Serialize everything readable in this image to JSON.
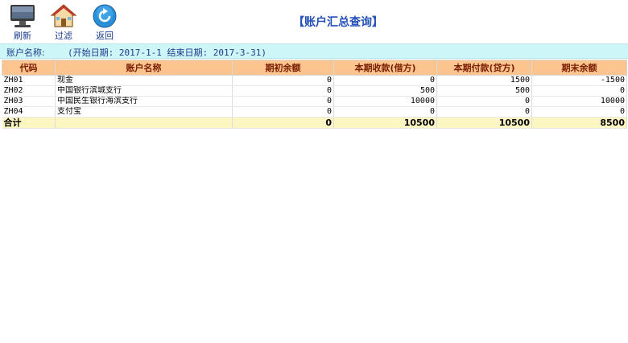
{
  "toolbar": {
    "refresh_label": "刷新",
    "filter_label": "过滤",
    "back_label": "返回"
  },
  "title": "【账户汇总查询】",
  "info": {
    "account_label": "账户名称:",
    "date_range": "(开始日期: 2017-1-1 结束日期: 2017-3-31)"
  },
  "table": {
    "headers": [
      "代码",
      "账户名称",
      "期初余额",
      "本期收款(借方)",
      "本期付款(贷方)",
      "期末余额"
    ],
    "rows": [
      {
        "code": "ZH01",
        "name": "现金",
        "opening": "0",
        "debit": "0",
        "credit": "1500",
        "closing": "-1500"
      },
      {
        "code": "ZH02",
        "name": "中国银行滨城支行",
        "opening": "0",
        "debit": "500",
        "credit": "500",
        "closing": "0"
      },
      {
        "code": "ZH03",
        "name": "中国民生银行海滨支行",
        "opening": "0",
        "debit": "10000",
        "credit": "0",
        "closing": "10000"
      },
      {
        "code": "ZH04",
        "name": "支付宝",
        "opening": "0",
        "debit": "0",
        "credit": "0",
        "closing": "0"
      }
    ],
    "total": {
      "label": "合计",
      "name": "",
      "opening": "0",
      "debit": "10500",
      "credit": "10500",
      "closing": "8500"
    }
  },
  "colors": {
    "header_bg": "#fcc48e",
    "info_bg": "#ccf6f8",
    "total_bg": "#fdf6c3",
    "title": "#2451b8"
  },
  "icons": [
    "monitor-icon",
    "house-icon",
    "return-arrow-icon"
  ]
}
